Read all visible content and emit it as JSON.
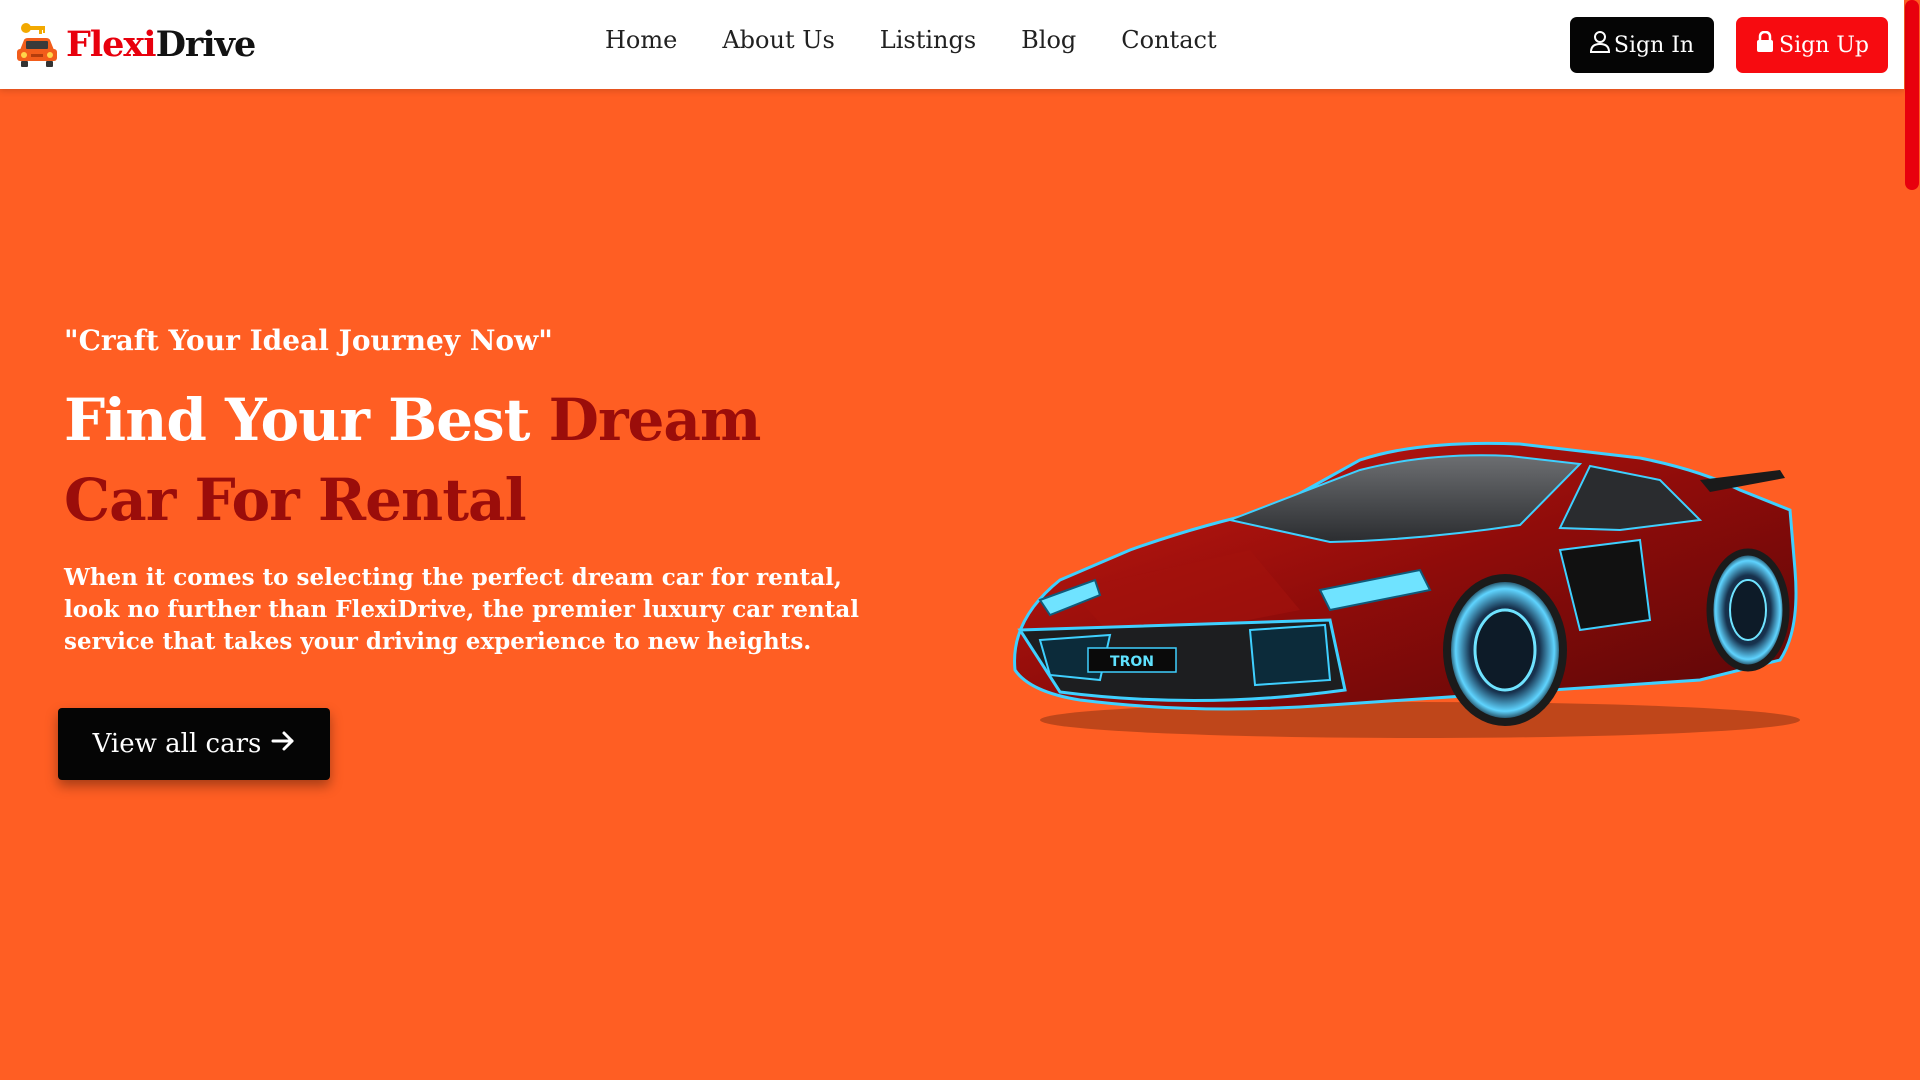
{
  "brand": {
    "name_part1": "Flexi",
    "name_part2": "Drive",
    "logo_icon": "car-key-icon"
  },
  "nav": {
    "links": [
      "Home",
      "About Us",
      "Listings",
      "Blog",
      "Contact"
    ]
  },
  "auth": {
    "sign_in_label": "Sign In",
    "sign_in_icon": "user-icon",
    "sign_up_label": "Sign Up",
    "sign_up_icon": "lock-icon"
  },
  "hero": {
    "tagline": "\"Craft Your Ideal Journey Now\"",
    "title_white": "Find Your Best ",
    "title_accent": "Dream Car For Rental",
    "description": "When it comes to selecting the perfect dream car for rental, look no further than FlexiDrive, the premier luxury car rental service that takes your driving experience to new heights.",
    "cta_label": "View all cars",
    "cta_icon": "arrow-right-icon",
    "car_plate": "TRON"
  },
  "colors": {
    "primary_orange": "#ff5e23",
    "brand_red": "#e8000d",
    "accent_dark_red": "#9b0d0a",
    "black": "#050505",
    "white": "#ffffff"
  }
}
